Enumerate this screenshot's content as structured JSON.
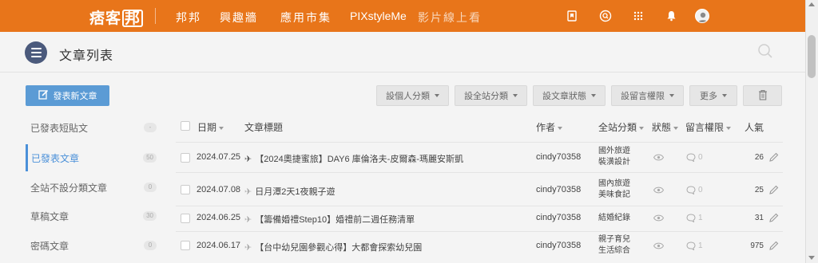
{
  "topbar": {
    "logo_a": "痞客",
    "logo_b": "邦",
    "nav": [
      "邦邦",
      "興趣牆",
      "應用市集",
      "PIXstyleMe",
      "影片線上看"
    ],
    "icons": [
      "bookmark-icon",
      "search-circle-icon",
      "grid-icon",
      "bell-icon",
      "avatar"
    ]
  },
  "header": {
    "title": "文章列表"
  },
  "actions": {
    "new_post": "發表新文章",
    "toolbar": [
      "設個人分類",
      "設全站分類",
      "設文章狀態",
      "設留言權限",
      "更多"
    ]
  },
  "sidebar": [
    {
      "label": "已發表短貼文",
      "count": "-"
    },
    {
      "label": "已發表文章",
      "count": "50"
    },
    {
      "label": "全站不設分類文章",
      "count": "0"
    },
    {
      "label": "草稿文章",
      "count": "30"
    },
    {
      "label": "密碼文章",
      "count": "0"
    }
  ],
  "table": {
    "headers": {
      "date": "日期",
      "title": "文章標題",
      "author": "作者",
      "site_category": "全站分類",
      "status": "狀態",
      "comment_perm": "留言權限",
      "popularity": "人氣"
    },
    "rows": [
      {
        "date": "2024.07.25",
        "icon": "✈",
        "title": "【2024奧捷蜜旅】DAY6 庫倫洛夫-皮爾森-瑪麗安斯凱",
        "author": "cindy70358",
        "cat1": "國外旅遊",
        "cat2": "裝潢設計",
        "comments": "0",
        "views": "26"
      },
      {
        "date": "2024.07.08",
        "icon": "✈",
        "title": "日月潭2天1夜親子遊",
        "author": "cindy70358",
        "cat1": "國內旅遊",
        "cat2": "美味食記",
        "comments": "0",
        "views": "25"
      },
      {
        "date": "2024.06.25",
        "icon": "✈",
        "title": "【籌備婚禮Step10】婚禮前二週任務清單",
        "author": "cindy70358",
        "cat1": "結婚紀錄",
        "cat2": "",
        "comments": "1",
        "views": "31"
      },
      {
        "date": "2024.06.17",
        "icon": "✈",
        "title": "【台中幼兒園參觀心得】大都會探索幼兒園",
        "author": "cindy70358",
        "cat1": "親子育兒",
        "cat2": "生活綜合",
        "comments": "1",
        "views": "975"
      }
    ]
  }
}
